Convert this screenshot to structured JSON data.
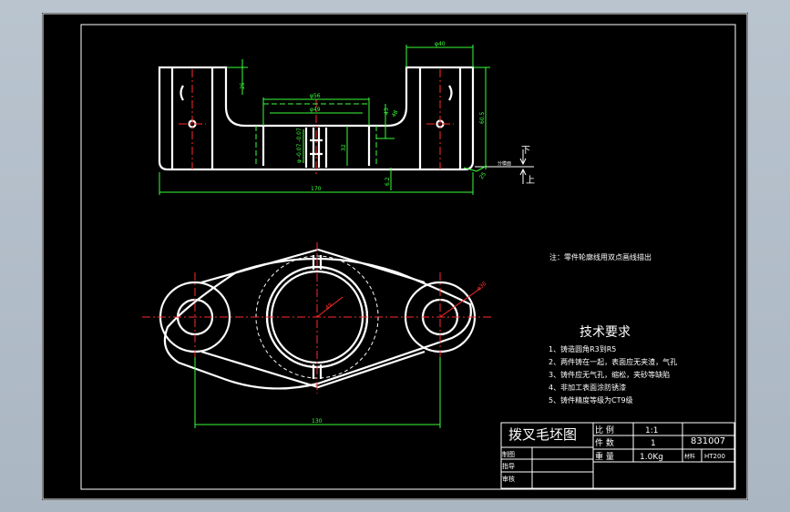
{
  "dimensions": {
    "phi40": "φ40",
    "phi56": "φ56",
    "phi49": "φ49",
    "d25": "25",
    "d605": "60.5",
    "d43": "43",
    "d48": "48",
    "phi_tol": "φ -0.07 -0.07",
    "d32": "32",
    "d62": "6.2",
    "d170": "170",
    "d130": "130",
    "d49b": "49",
    "phi36": "φ36",
    "d25b": "25"
  },
  "parting": {
    "label": "分模面",
    "top": "下",
    "bottom": "上"
  },
  "note": "注：零件轮廓线用双点画线描出",
  "tech_req": {
    "title": "技术要求",
    "items": [
      "1、铸造圆角R3到R5",
      "2、两件铸在一起，表面应无夹渣，气孔",
      "3、铸件应无气孔，缩松，夹砂等缺陷",
      "4、非加工表面涂防锈漆",
      "5、铸件精度等级为CT9级"
    ]
  },
  "title_block": {
    "title": "拨叉毛坯图",
    "scale_label": "比 例",
    "scale_value": "1:1",
    "count_label": "件 数",
    "count_value": "1",
    "weight_label": "重 量",
    "weight_value": "1.0Kg",
    "material_label": "材料",
    "material_value": "HT200",
    "drawing_no": "831007",
    "drawn": "制图",
    "guide": "指导",
    "review": "审核"
  }
}
